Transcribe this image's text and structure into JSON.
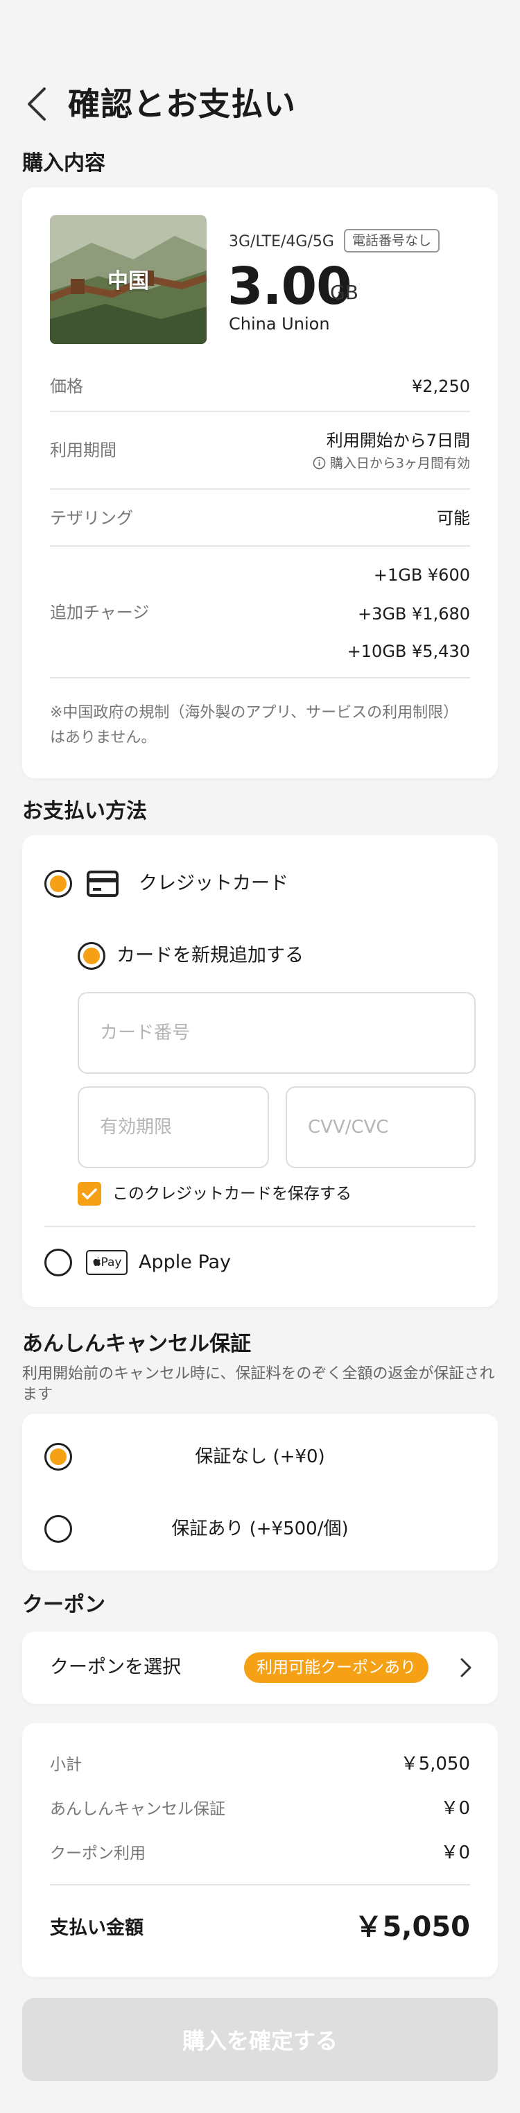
{
  "header": {
    "title": "確認とお支払い"
  },
  "purchase": {
    "heading": "購入内容",
    "thumbnail_label": "中国",
    "network": "3G/LTE/4G/5G",
    "badge": "電話番号なし",
    "data_amount": "3.00",
    "data_unit": "GB",
    "carrier": "China Union",
    "price_label": "価格",
    "price_value": "¥2,250",
    "period_label": "利用期間",
    "period_value": "利用開始から7日間",
    "period_sub": "購入日から3ヶ月間有効",
    "tethering_label": "テザリング",
    "tethering_value": "可能",
    "addon_label": "追加チャージ",
    "addons": [
      "+1GB ¥600",
      "+3GB ¥1,680",
      "+10GB ¥5,430"
    ],
    "note": "※中国政府の規制（海外製のアプリ、サービスの利用制限）はありません。"
  },
  "payment": {
    "heading": "お支払い方法",
    "credit_card_label": "クレジットカード",
    "add_new_card_label": "カードを新規追加する",
    "card_number_placeholder": "カード番号",
    "expiry_placeholder": "有効期限",
    "cvv_placeholder": "CVV/CVC",
    "save_card_label": "このクレジットカードを保存する",
    "apple_pay_badge": "Pay",
    "apple_pay_label": "Apple Pay"
  },
  "cancel_guarantee": {
    "heading": "あんしんキャンセル保証",
    "note": "利用開始前のキャンセル時に、保証料をのぞく全額の返金が保証されます",
    "option_none": "保証なし (+¥0)",
    "option_with": "保証あり (+¥500/個)"
  },
  "coupon": {
    "heading": "クーポン",
    "select_label": "クーポンを選択",
    "available_badge": "利用可能クーポンあり"
  },
  "summary": {
    "subtotal_label": "小計",
    "subtotal_value": "￥5,050",
    "guarantee_label": "あんしんキャンセル保証",
    "guarantee_value": "￥0",
    "coupon_label": "クーポン利用",
    "coupon_value": "￥0",
    "total_label": "支払い金額",
    "total_value": "￥5,050"
  },
  "confirm_button": "購入を確定する",
  "colors": {
    "accent": "#f5a015",
    "background": "#f4f4f4",
    "disabled": "#dedede"
  }
}
